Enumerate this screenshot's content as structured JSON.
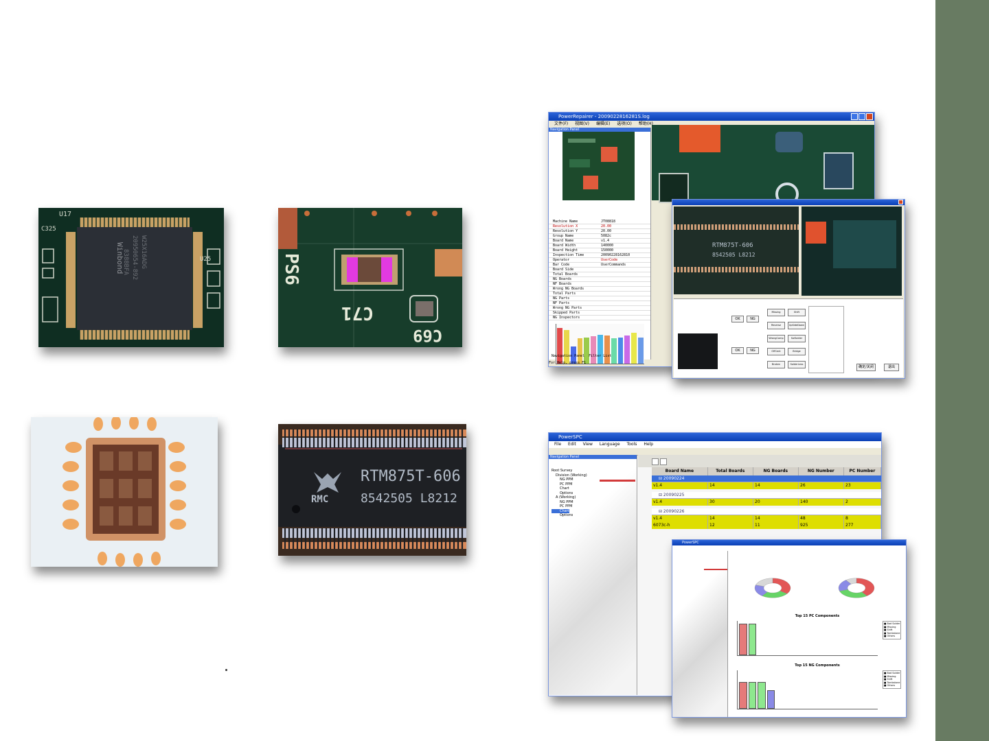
{
  "slide": {
    "accent_color": "#687b62"
  },
  "photos": {
    "winbond_chip": {
      "lines": [
        "Winbond",
        "W25X16ADG",
        "20950654-892",
        "8388BFA"
      ],
      "labels": [
        "U17",
        "C325",
        "U25"
      ]
    },
    "resistor": {
      "labels": [
        "PS6",
        "C71",
        "C69"
      ]
    },
    "xray_chip": {},
    "realtek_chip": {
      "line1": "RTM875T-606",
      "line2": "8542505 L8212",
      "logo": "RMC"
    }
  },
  "repair_window": {
    "title": "PowerRepairer - 2009022816281S.log",
    "menu": [
      "文件(F)",
      "视图(V)",
      "编辑(E)",
      "选项(O)",
      "帮助(H)"
    ],
    "nav_panel_title": "Navigation Panel",
    "info_rows": [
      [
        "Machine Name",
        "JT08818"
      ],
      [
        "Resolution X",
        "20.00"
      ],
      [
        "Resolution Y",
        "20.00"
      ],
      [
        "Group Name",
        "5082c"
      ],
      [
        "Board Name",
        "v1.4"
      ],
      [
        "Board Width",
        "140000"
      ],
      [
        "Board Height",
        "150000"
      ],
      [
        "Inspection Time",
        "20090228162810"
      ],
      [
        "Operator",
        "UserCode"
      ],
      [
        "Bar Code",
        "UserCommands"
      ],
      [
        "Board Side",
        ""
      ],
      [
        "Total Boards",
        ""
      ],
      [
        "NG Boards",
        ""
      ],
      [
        "NF Boards",
        ""
      ],
      [
        "Wrong NG Boards",
        ""
      ],
      [
        "Total Parts",
        ""
      ],
      [
        "NG Parts",
        ""
      ],
      [
        "NF Parts",
        ""
      ],
      [
        "Wrong NG Parts",
        ""
      ],
      [
        "Skipped Parts",
        ""
      ],
      [
        "NG Inspectors",
        ""
      ]
    ],
    "status_text": "For Help, press F1",
    "tabs": [
      "Navigation Panel",
      "Filter List"
    ],
    "chart_values": [
      1.0,
      0.95,
      0.48,
      0.72,
      0.74,
      0.77,
      0.81,
      0.78,
      0.71,
      0.74,
      0.78,
      0.86,
      0.74
    ]
  },
  "repair_dialog": {
    "chip_text": "RTM875T-606",
    "chip_text2": "8542505 L8212",
    "buttons_ok": "OK",
    "buttons_ng": "NG",
    "side_buttons": [
      "Missing",
      "Shift",
      "Reverse",
      "UpSideDown",
      "WrongComp",
      "SolSolder",
      "OffCent",
      "Bridge",
      "Broken",
      "SolderLess"
    ],
    "bottom_left_btn": "确定/关闭",
    "bottom_right_btn": "退出"
  },
  "spc_window": {
    "title": "PowerSPC",
    "menu": [
      "File",
      "Edit",
      "View",
      "Language",
      "Tools",
      "Help"
    ],
    "nav_title": "Navigation Panel",
    "tree": [
      "Root Survey",
      "Division (Working)",
      "NG PPM",
      "PC PPM",
      "Chart",
      "Options",
      "A (Working)",
      "NG PPM",
      "PC PPM",
      "Chart",
      "Options"
    ],
    "table_headers": [
      "Board Name",
      "Total Boards",
      "NG Boards",
      "NG Number",
      "PC Number"
    ],
    "groups": [
      {
        "name": "20090224",
        "selected": true,
        "rows": [
          [
            "v1.4",
            "14",
            "14",
            "26",
            "23"
          ]
        ]
      },
      {
        "name": "20090225",
        "selected": false,
        "rows": [
          [
            "v1.4",
            "30",
            "20",
            "140",
            "2"
          ]
        ]
      },
      {
        "name": "20090226",
        "selected": false,
        "rows": [
          [
            "v1.4",
            "14",
            "14",
            "48",
            "8"
          ],
          [
            "6073c-h",
            "12",
            "11",
            "925",
            "277"
          ]
        ]
      }
    ]
  },
  "spc_chart_window": {
    "title": "PowerSPC",
    "chart1_title": "Top 15 PC Components",
    "chart2_title": "Top 15 NG Components",
    "legend": [
      "Bad Solder",
      "Missing",
      "Shift",
      "Tombstone",
      "Others"
    ],
    "chart_data": [
      {
        "type": "pie",
        "slices": [
          {
            "name": "BadSolder",
            "value": 35
          },
          {
            "name": "Missing",
            "value": 25
          },
          {
            "name": "Shift",
            "value": 20
          },
          {
            "name": "Others",
            "value": 20
          }
        ]
      },
      {
        "type": "pie",
        "slices": [
          {
            "name": "BadSolder",
            "value": 40
          },
          {
            "name": "Missing",
            "value": 30
          },
          {
            "name": "Shift",
            "value": 20
          },
          {
            "name": "Others",
            "value": 10
          }
        ]
      },
      {
        "type": "bar",
        "values": [
          8,
          8,
          0,
          0,
          0,
          0,
          0,
          0,
          0,
          0,
          0,
          0,
          0,
          0,
          0
        ]
      },
      {
        "type": "bar",
        "values": [
          6,
          6,
          6,
          4,
          0,
          0,
          0,
          0,
          0,
          0,
          0,
          0,
          0,
          0,
          0
        ]
      }
    ]
  }
}
